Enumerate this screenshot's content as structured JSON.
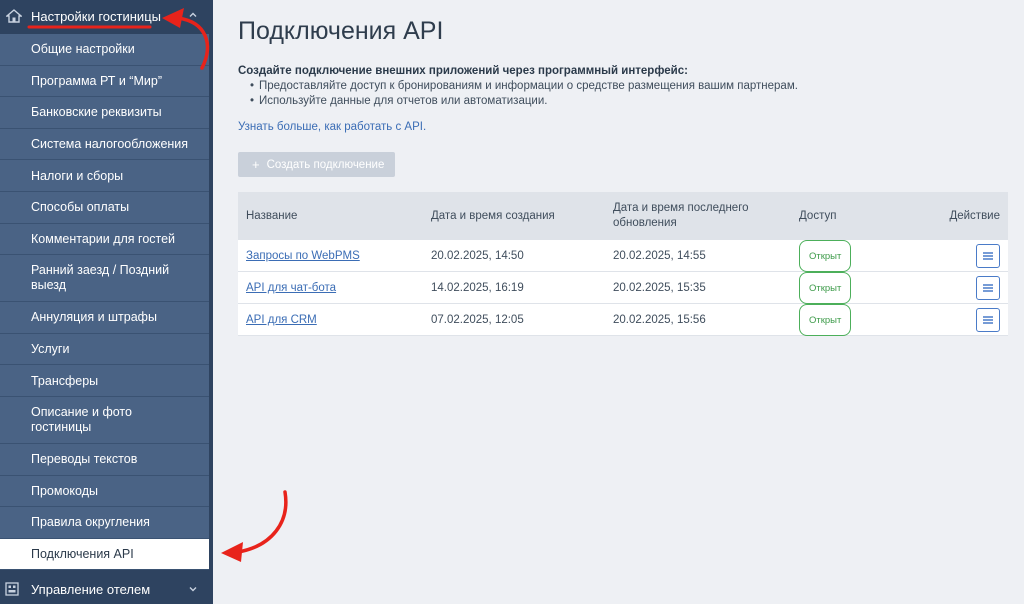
{
  "sidebar": {
    "header": {
      "title": "Настройки гостиницы",
      "icon": "home-icon",
      "chevron": "chevron-up-icon"
    },
    "items": [
      {
        "label": "Общие настройки"
      },
      {
        "label": "Программа РТ и “Мир”"
      },
      {
        "label": "Банковские реквизиты"
      },
      {
        "label": "Система налогообложения"
      },
      {
        "label": "Налоги и сборы"
      },
      {
        "label": "Способы оплаты"
      },
      {
        "label": "Комментарии для гостей"
      },
      {
        "label": "Ранний заезд / Поздний выезд"
      },
      {
        "label": "Аннуляция и штрафы"
      },
      {
        "label": "Услуги"
      },
      {
        "label": "Трансферы"
      },
      {
        "label": "Описание и фото гостиницы"
      },
      {
        "label": "Переводы текстов"
      },
      {
        "label": "Промокоды"
      },
      {
        "label": "Правила округления"
      },
      {
        "label": "Подключения API"
      }
    ],
    "active_item": "Подключения API",
    "footer": {
      "title": "Управление отелем",
      "icon": "hotel-management-icon",
      "chevron": "chevron-down-icon"
    }
  },
  "main": {
    "title": "Подключения API",
    "intro_lead": "Создайте подключение внешних приложений через программный интерфейс:",
    "bullets": [
      "Предоставляйте доступ к бронированиям и информации о средстве размещения вашим партнерам.",
      "Используйте данные для отчетов или автоматизации."
    ],
    "learn_more": "Узнать больше, как работать с API.",
    "create_button": {
      "icon": "plus-icon",
      "label": "Создать подключение"
    },
    "table": {
      "headers": {
        "name": "Название",
        "created": "Дата и время создания",
        "updated": "Дата и время последнего обновления",
        "access": "Доступ",
        "action": "Действие"
      },
      "rows": [
        {
          "name": "Запросы по WebPMS",
          "created": "20.02.2025, 14:50",
          "updated": "20.02.2025, 14:55",
          "access": "Открыт"
        },
        {
          "name": "API для чат-бота",
          "created": "14.02.2025, 16:19",
          "updated": "20.02.2025, 15:35",
          "access": "Открыт"
        },
        {
          "name": "API для CRM",
          "created": "07.02.2025, 12:05",
          "updated": "20.02.2025, 15:56",
          "access": "Открыт"
        }
      ]
    }
  },
  "colors": {
    "sidebar_dark": "#2e4360",
    "sidebar_item": "#4a6385",
    "link": "#3b6db5",
    "badge_green": "#4caf5a",
    "annotation_red": "#e8231b"
  }
}
